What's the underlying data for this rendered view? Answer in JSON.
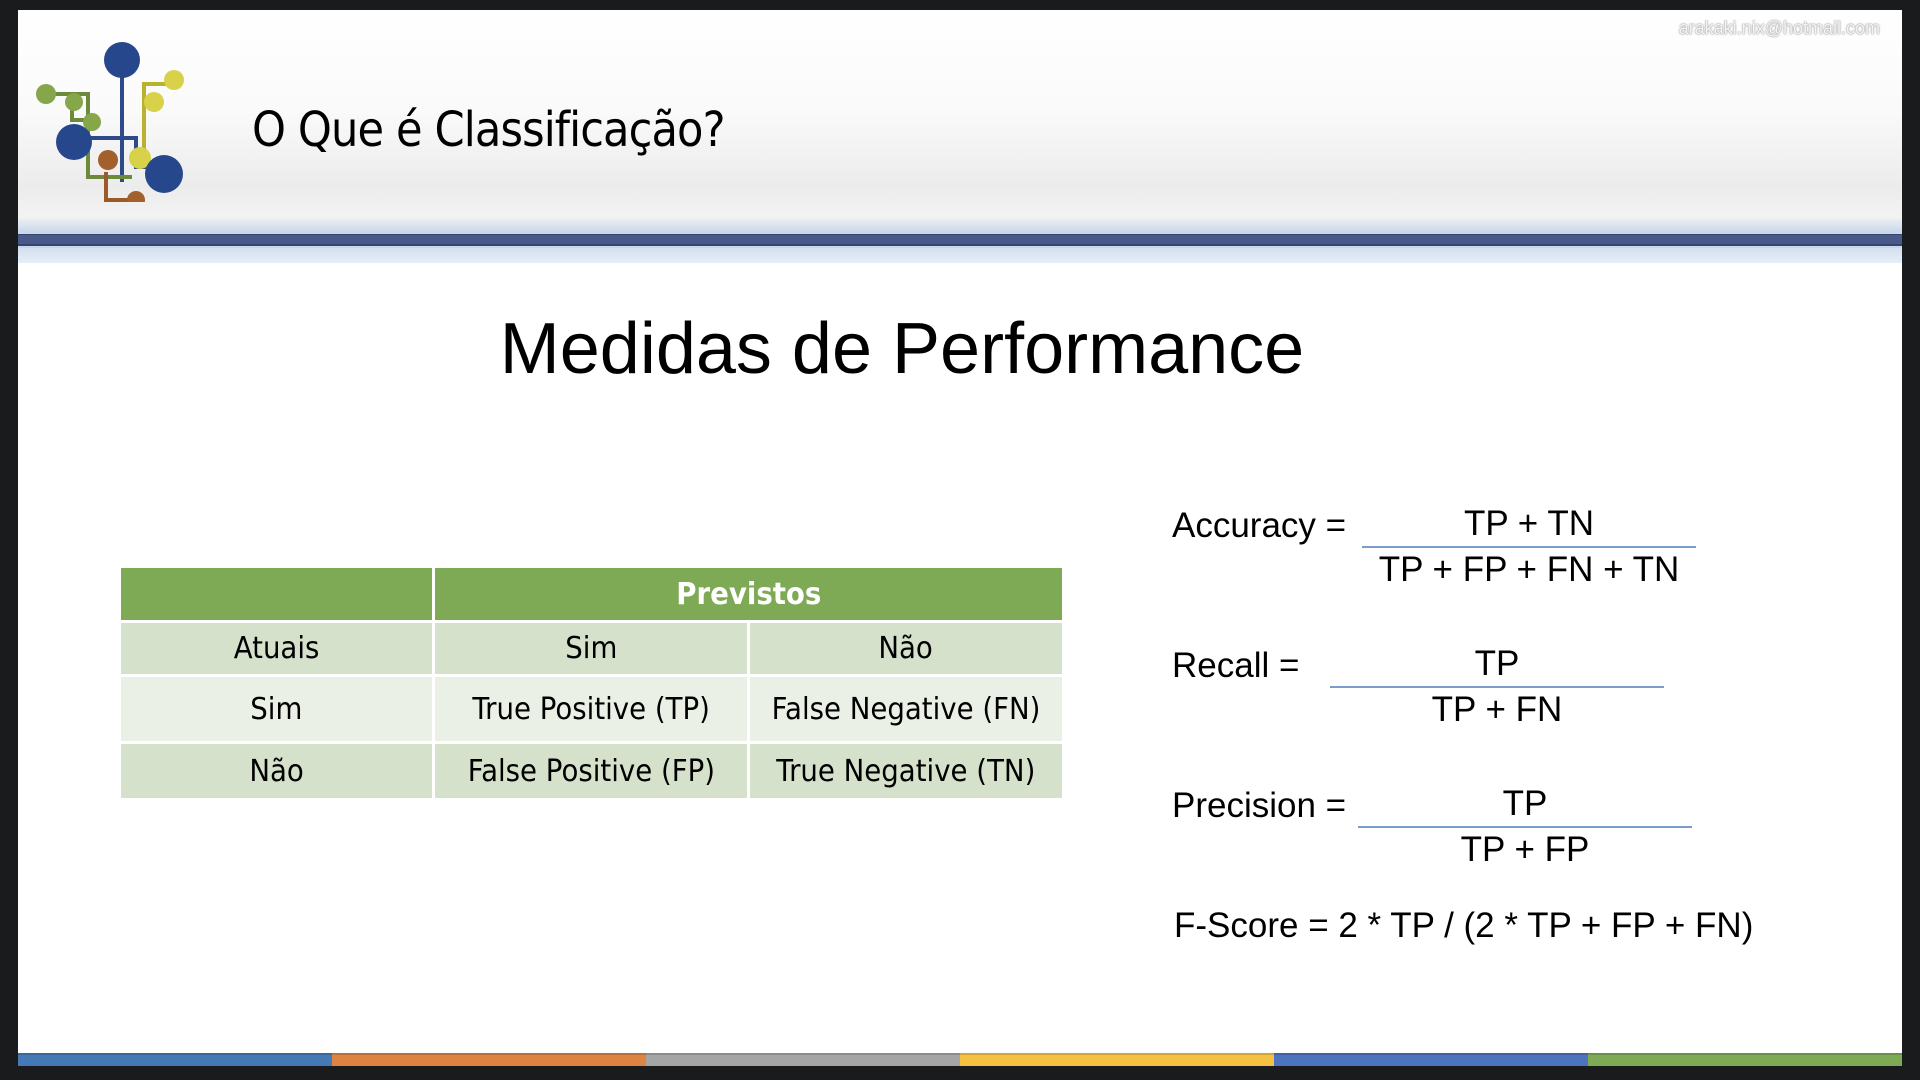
{
  "header": {
    "title": "O Que é Classificação?",
    "email": "arakaki.nix@hotmail.com"
  },
  "slide": {
    "title": "Medidas de Performance"
  },
  "table": {
    "header": [
      "",
      "Previstos"
    ],
    "rows": [
      [
        "Atuais",
        "Sim",
        "Não"
      ],
      [
        "Sim",
        "True Positive (TP)",
        "False Negative (FN)"
      ],
      [
        "Não",
        "False Positive (FP)",
        "True Negative (TN)"
      ]
    ]
  },
  "formulas": {
    "accuracy": {
      "label": "Accuracy =",
      "num": "TP + TN",
      "den": "TP + FP + FN + TN"
    },
    "recall": {
      "label": "Recall =",
      "num": "TP",
      "den": "TP + FN"
    },
    "precision": {
      "label": "Precision =",
      "num": "TP",
      "den": "TP + FP"
    },
    "fscore": "F-Score = 2 * TP / (2 * TP + FP + FN)"
  },
  "colors": {
    "table_header": "#7eaa55",
    "header_bar": "#475a8a",
    "footer": [
      "#4479b6",
      "#dd8443",
      "#a5a5a5",
      "#f5c142",
      "#4d74bf",
      "#7ea955"
    ]
  }
}
